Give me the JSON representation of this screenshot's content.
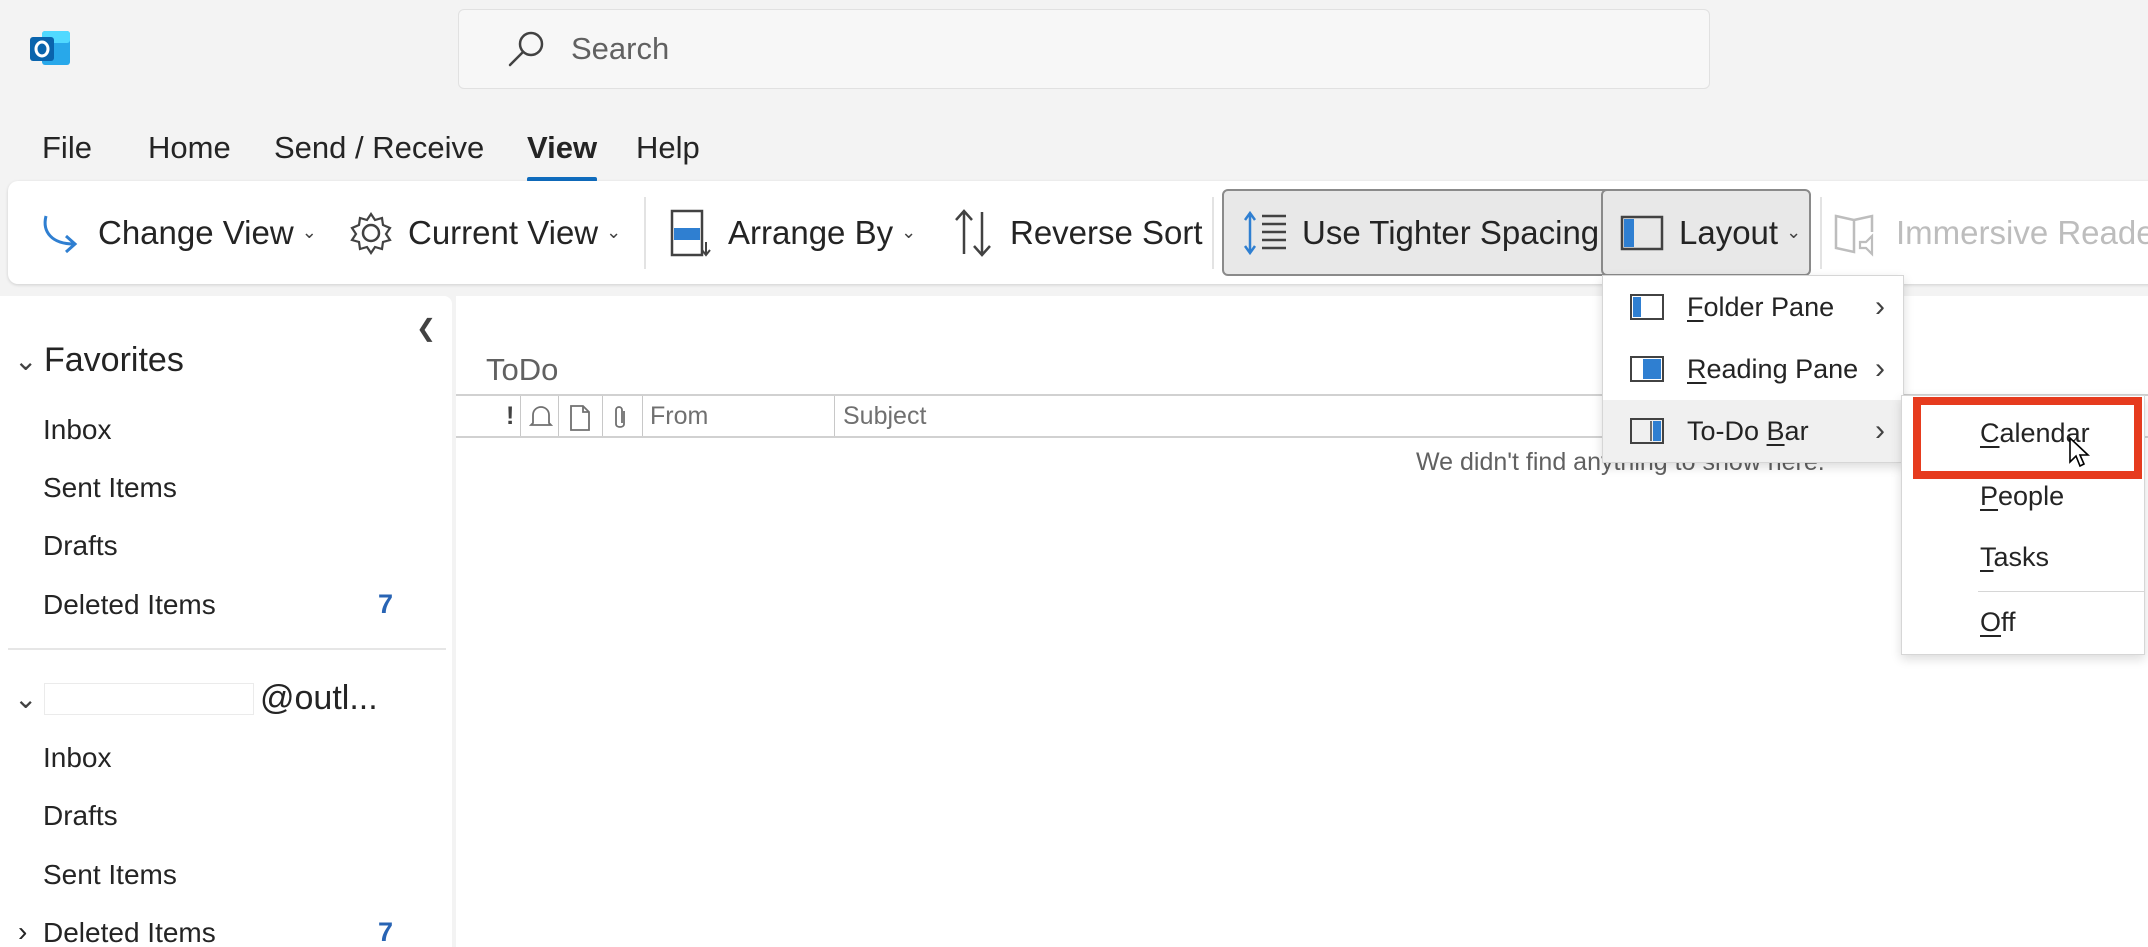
{
  "app": {
    "logo_icon": "outlook-logo-icon",
    "brand_color": "#0f6cbd"
  },
  "search": {
    "placeholder": "Search",
    "icon": "search-icon"
  },
  "tabs": [
    {
      "label": "File",
      "active": false
    },
    {
      "label": "Home",
      "active": false
    },
    {
      "label": "Send / Receive",
      "active": false
    },
    {
      "label": "View",
      "active": true
    },
    {
      "label": "Help",
      "active": false
    }
  ],
  "ribbon": {
    "change_view": "Change View",
    "current_view": "Current View",
    "arrange_by": "Arrange By",
    "reverse_sort": "Reverse Sort",
    "tighter_spacing": "Use Tighter Spacing",
    "layout": "Layout",
    "immersive_reader": "Immersive Reader"
  },
  "sidebar": {
    "favorites": {
      "title": "Favorites",
      "items": [
        {
          "label": "Inbox",
          "count": ""
        },
        {
          "label": "Sent Items",
          "count": ""
        },
        {
          "label": "Drafts",
          "count": ""
        },
        {
          "label": "Deleted Items",
          "count": "7"
        }
      ]
    },
    "account": {
      "title": "@outl...",
      "items": [
        {
          "label": "Inbox",
          "count": ""
        },
        {
          "label": "Drafts",
          "count": ""
        },
        {
          "label": "Sent Items",
          "count": ""
        },
        {
          "label": "Deleted Items",
          "count": "7"
        }
      ]
    }
  },
  "main": {
    "folder_title": "ToDo",
    "columns": {
      "importance": "!",
      "from": "From",
      "subject": "Subject"
    },
    "empty_message": "We didn't find anything to show here."
  },
  "layout_menu": {
    "items": [
      {
        "label_first": "F",
        "label_rest": "older Pane"
      },
      {
        "label_first": "R",
        "label_rest": "eading Pane"
      },
      {
        "label_pre": "To-Do ",
        "label_first": "B",
        "label_rest": "ar"
      }
    ]
  },
  "todo_submenu": {
    "items": [
      {
        "label_first": "C",
        "label_rest": "alendar"
      },
      {
        "label_first": "P",
        "label_rest": "eople"
      },
      {
        "label_first": "T",
        "label_rest": "asks"
      },
      {
        "label_first": "O",
        "label_rest": "ff"
      }
    ],
    "highlight_color": "#e63b1e"
  }
}
